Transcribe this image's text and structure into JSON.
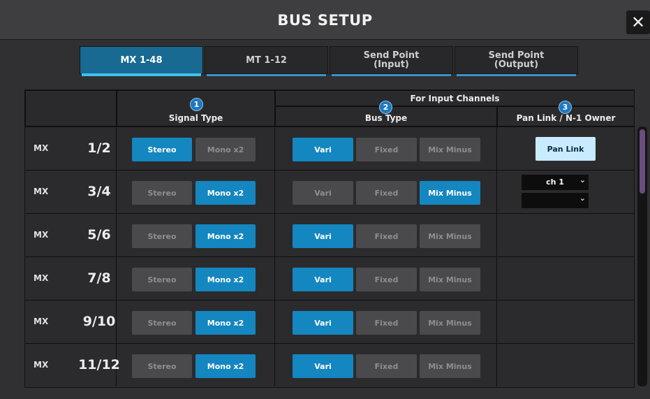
{
  "title": "BUS SETUP",
  "close_glyph": "✕",
  "tabs": [
    {
      "label": "MX 1-48",
      "active": true
    },
    {
      "label": "MT 1-12",
      "active": false
    },
    {
      "label_line1": "Send Point",
      "label_line2": "(Input)",
      "active": false
    },
    {
      "label_line1": "Send Point",
      "label_line2": "(Output)",
      "active": false
    }
  ],
  "headers": {
    "signal_type": "Signal Type",
    "for_input_channels": "For Input Channels",
    "bus_type": "Bus Type",
    "pan_link_owner": "Pan Link / N-1 Owner",
    "badges": [
      "1",
      "2",
      "3"
    ]
  },
  "labels": {
    "stereo": "Stereo",
    "mono_x2": "Mono x2",
    "vari": "Vari",
    "fixed": "Fixed",
    "mix_minus": "Mix Minus",
    "pan_link": "Pan Link"
  },
  "rows": [
    {
      "prefix": "MX",
      "number": "1/2",
      "signal": "Stereo",
      "bus": "Vari",
      "extra": "pan_link"
    },
    {
      "prefix": "MX",
      "number": "3/4",
      "signal": "Mono x2",
      "bus": "Mix Minus",
      "extra": "owner"
    },
    {
      "prefix": "MX",
      "number": "5/6",
      "signal": "Mono x2",
      "bus": "Vari",
      "extra": ""
    },
    {
      "prefix": "MX",
      "number": "7/8",
      "signal": "Mono x2",
      "bus": "Vari",
      "extra": ""
    },
    {
      "prefix": "MX",
      "number": "9/10",
      "signal": "Mono x2",
      "bus": "Vari",
      "extra": ""
    },
    {
      "prefix": "MX",
      "number": "11/12",
      "signal": "Mono x2",
      "bus": "Vari",
      "extra": ""
    }
  ],
  "owner_select": {
    "value1": "ch 1",
    "value2": "",
    "chevron": "⌄"
  },
  "colors": {
    "accent": "#1486c0",
    "tab_active": "#186a93",
    "pan_link": "#c8ebff",
    "scroll_thumb": "#6a4c7e"
  }
}
